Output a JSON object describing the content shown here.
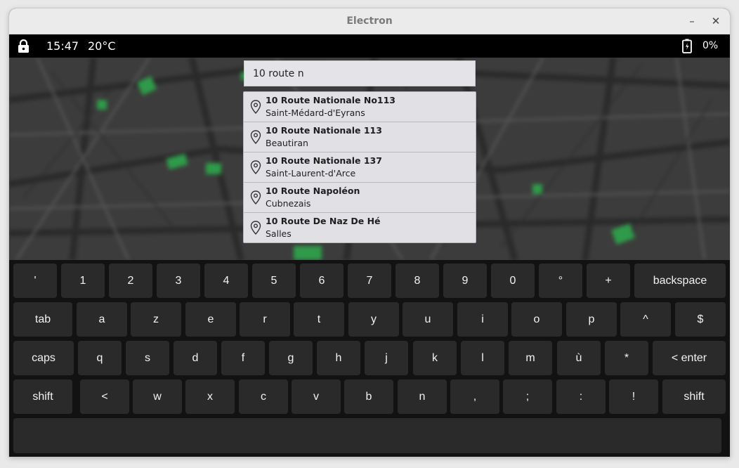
{
  "window": {
    "title": "Electron",
    "minimize_label": "–",
    "close_label": "✕"
  },
  "status": {
    "lock_icon": "lock-icon",
    "time": "15:47",
    "temperature": "20°C",
    "battery_icon": "battery-charging-icon",
    "battery_percent": "0%"
  },
  "search": {
    "value": "10 route n"
  },
  "suggestions": [
    {
      "name": "10 Route Nationale No113",
      "city": "Saint-Médard-d'Eyrans"
    },
    {
      "name": "10 Route Nationale 113",
      "city": "Beautiran"
    },
    {
      "name": "10 Route Nationale 137",
      "city": "Saint-Laurent-d'Arce"
    },
    {
      "name": "10 Route Napoléon",
      "city": "Cubnezais"
    },
    {
      "name": "10 Route De Naz De Hé",
      "city": "Salles"
    }
  ],
  "keyboard": {
    "rows": [
      [
        "'",
        "1",
        "2",
        "3",
        "4",
        "5",
        "6",
        "7",
        "8",
        "9",
        "0",
        "°",
        "+",
        "backspace"
      ],
      [
        "tab",
        "a",
        "z",
        "e",
        "r",
        "t",
        "y",
        "u",
        "i",
        "o",
        "p",
        "^",
        "$"
      ],
      [
        "caps",
        "q",
        "s",
        "d",
        "f",
        "g",
        "h",
        "j",
        "k",
        "l",
        "m",
        "ù",
        "*",
        "< enter"
      ],
      [
        "shift",
        "<",
        "w",
        "x",
        "c",
        "v",
        "b",
        "n",
        ",",
        ";",
        ":",
        "!",
        "shift"
      ],
      [
        ""
      ]
    ]
  },
  "colors": {
    "map_green": "#2f9a4a",
    "key_bg": "#2a2a2a",
    "keyboard_bg": "#121212"
  }
}
